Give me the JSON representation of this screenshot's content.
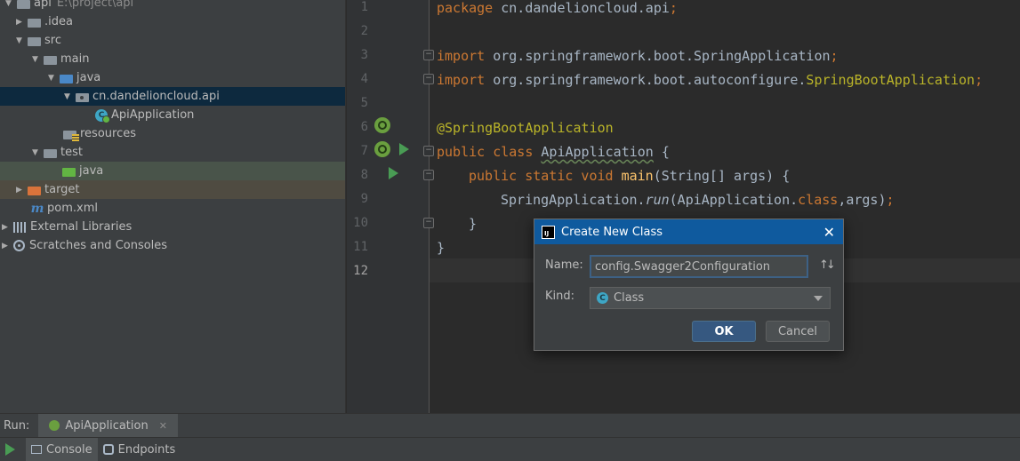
{
  "project_tree": {
    "root": {
      "label": "api",
      "hint": "E:\\project\\api"
    },
    "items": [
      {
        "label": ".idea"
      },
      {
        "label": "src"
      },
      {
        "label": "main"
      },
      {
        "label": "java"
      },
      {
        "label": "cn.dandelioncloud.api"
      },
      {
        "label": "ApiApplication"
      },
      {
        "label": "resources"
      },
      {
        "label": "test"
      },
      {
        "label": "java"
      },
      {
        "label": "target"
      },
      {
        "label": "pom.xml"
      },
      {
        "label": "External Libraries"
      },
      {
        "label": "Scratches and Consoles"
      }
    ]
  },
  "editor": {
    "line_numbers": [
      "1",
      "2",
      "3",
      "4",
      "5",
      "6",
      "7",
      "8",
      "9",
      "10",
      "11",
      "12"
    ],
    "lines": {
      "l1_kw": "package",
      "l1_rest": " cn.dandelioncloud.api",
      "l1_semi": ";",
      "l3_kw": "import",
      "l3_rest": " org.springframework.boot.SpringApplication",
      "l3_semi": ";",
      "l4_kw": "import",
      "l4_rest": " org.springframework.boot.autoconfigure.",
      "l4_ann": "SpringBootApplication",
      "l4_semi": ";",
      "l6_ann": "@SpringBootApplication",
      "l7_kw": "public class",
      "l7_name": "ApiApplication",
      "l7_rest": " {",
      "l8_kw": "public static void",
      "l8_fn": "main",
      "l8_rest": "(String[] args) {",
      "l9_a": "SpringApplication.",
      "l9_run": "run",
      "l9_b": "(ApiApplication.",
      "l9_kw": "class",
      "l9_c": ",args)",
      "l9_semi": ";",
      "l10": "}",
      "l11": "}"
    }
  },
  "run_bar": {
    "label": "Run:",
    "tab": "ApiApplication"
  },
  "console_bar": {
    "console_tab": "Console",
    "endpoints_tab": "Endpoints"
  },
  "dialog": {
    "title": "Create New Class",
    "name_label": "Name:",
    "name_value": "config.Swagger2Configuration",
    "kind_label": "Kind:",
    "kind_value": "Class",
    "ok_label": "OK",
    "cancel_label": "Cancel"
  },
  "colors": {
    "keyword": "#cc7832",
    "annotation": "#bbb529",
    "function": "#ffc66d",
    "dialog_title_bg": "#0f5a9e",
    "selection": "#0d293e"
  }
}
